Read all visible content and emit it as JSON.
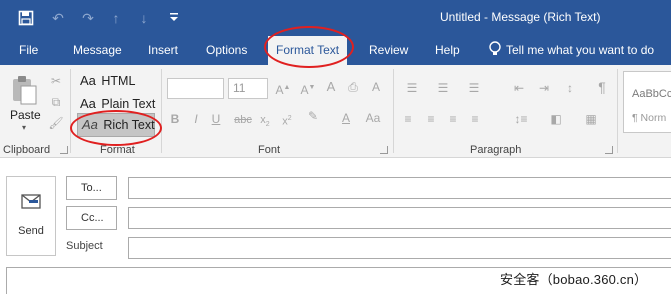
{
  "window": {
    "title": "Untitled  -  Message (Rich Text)"
  },
  "quick_access": {
    "save_icon": "save-icon",
    "undo_icon": "undo-icon",
    "redo_icon": "redo-icon",
    "up_icon": "arrow-up-icon",
    "down_icon": "arrow-down-icon",
    "customize_icon": "customize-qat-icon"
  },
  "tabs": [
    {
      "label": "File"
    },
    {
      "label": "Message"
    },
    {
      "label": "Insert"
    },
    {
      "label": "Options"
    },
    {
      "label": "Format Text",
      "active": true
    },
    {
      "label": "Review"
    },
    {
      "label": "Help"
    }
  ],
  "tell_me": {
    "label": "Tell me what you want to do"
  },
  "ribbon": {
    "clipboard": {
      "label": "Clipboard",
      "paste_label": "Paste"
    },
    "format": {
      "label": "Format",
      "aa": "Aa",
      "html": "HTML",
      "plain": "Plain Text",
      "rich": "Rich Text",
      "selected": "Rich Text"
    },
    "font": {
      "label": "Font",
      "size_value": "11"
    },
    "paragraph": {
      "label": "Paragraph"
    },
    "styles": {
      "preview": "AaBbCc",
      "style_name": "¶ Norm"
    }
  },
  "compose": {
    "send_label": "Send",
    "to_label": "To...",
    "cc_label": "Cc...",
    "subject_label": "Subject",
    "to_value": "",
    "cc_value": "",
    "subject_value": ""
  },
  "watermark": "安全客（bobao.360.cn）",
  "colors": {
    "accent": "#2b579a",
    "annotation": "#e02020",
    "ribbon_bg": "#f3f3f3"
  }
}
